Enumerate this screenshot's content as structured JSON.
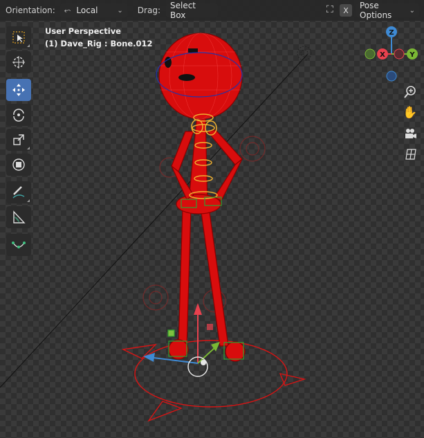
{
  "header": {
    "orientation_label": "Orientation:",
    "orientation_value": "Local",
    "drag_label": "Drag:",
    "drag_value": "Select Box",
    "close_label": "X",
    "pose_options_label": "Pose Options"
  },
  "viewport": {
    "perspective": "User Perspective",
    "active_object": "(1) Dave_Rig : Bone.012"
  },
  "gizmo": {
    "z": "Z",
    "x": "X",
    "y": "Y"
  },
  "toolbar": {
    "tools": [
      "select-box",
      "cursor",
      "move",
      "rotate",
      "scale",
      "transform",
      "annotate",
      "measure",
      "bone-envelope"
    ],
    "active": "move"
  },
  "navigation": [
    "zoom-icon",
    "hand-pan-icon",
    "camera-icon",
    "grid-icon"
  ],
  "colors": {
    "accent": "#4772b3",
    "x_axis": "#e8414e",
    "y_axis": "#7ab834",
    "z_axis": "#3e8ad4",
    "rig": "#e01010",
    "bone_selected": "#f0b030"
  }
}
